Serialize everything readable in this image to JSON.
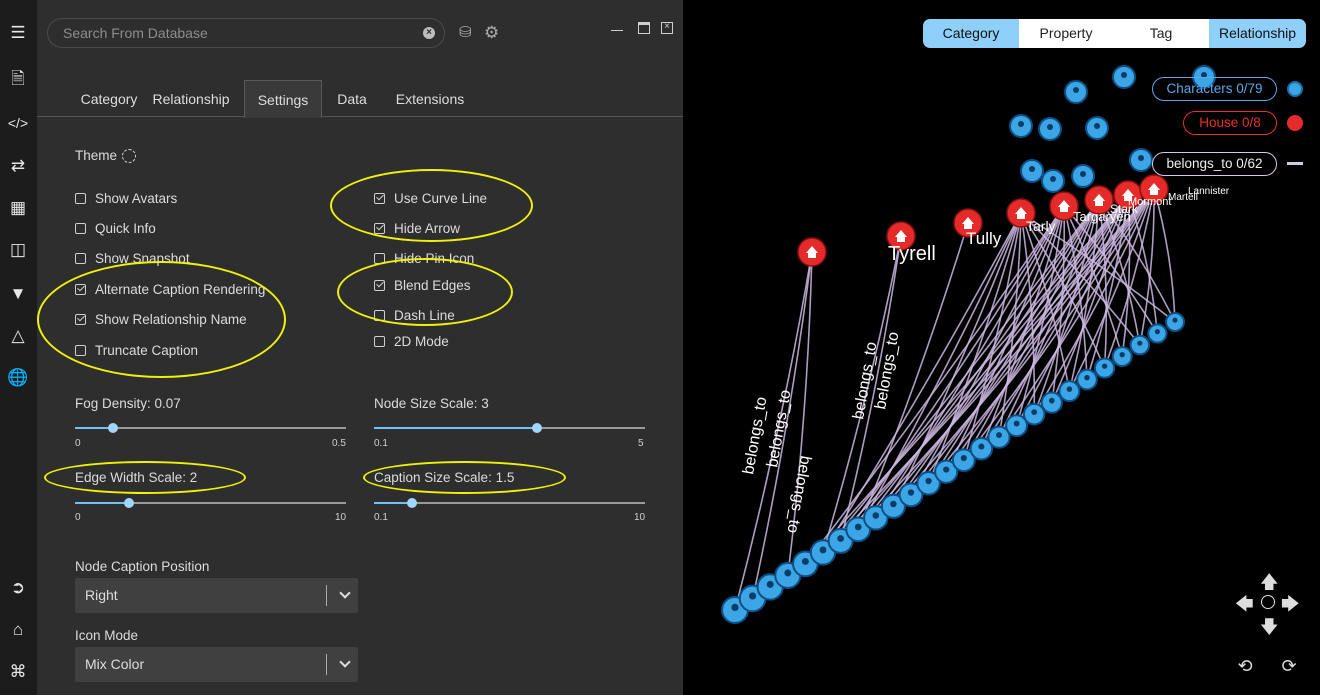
{
  "search": {
    "placeholder": "Search From Database"
  },
  "tabs": [
    "Category",
    "Relationship",
    "Settings",
    "Data",
    "Extensions"
  ],
  "settings": {
    "theme_label": "Theme",
    "left_options": [
      {
        "label": "Show Avatars",
        "checked": false
      },
      {
        "label": "Quick Info",
        "checked": false
      },
      {
        "label": "Show Snapshot",
        "checked": false
      },
      {
        "label": "Alternate Caption Rendering",
        "checked": true
      },
      {
        "label": "Show Relationship Name",
        "checked": true
      },
      {
        "label": "Truncate Caption",
        "checked": false
      }
    ],
    "right_options": [
      {
        "label": "Use Curve Line",
        "checked": true
      },
      {
        "label": "Hide Arrow",
        "checked": true
      },
      {
        "label": "Hide Pin Icon",
        "checked": false
      },
      {
        "label": "Blend Edges",
        "checked": true
      },
      {
        "label": "Dash Line",
        "checked": false
      },
      {
        "label": "2D Mode",
        "checked": false
      }
    ],
    "sliders": {
      "fog": {
        "label": "Fog Density: 0.07",
        "min": "0",
        "max": "0.5",
        "fraction": 0.14
      },
      "node_size": {
        "label": "Node Size Scale: 3",
        "min": "0.1",
        "max": "5",
        "fraction": 0.6
      },
      "edge_width": {
        "label": "Edge Width Scale: 2",
        "min": "0",
        "max": "10",
        "fraction": 0.2
      },
      "caption_size": {
        "label": "Caption Size Scale: 1.5",
        "min": "0.1",
        "max": "10",
        "fraction": 0.14
      }
    },
    "node_caption_position": {
      "label": "Node Caption Position",
      "value": "Right"
    },
    "icon_mode": {
      "label": "Icon Mode",
      "value": "Mix Color"
    }
  },
  "graph": {
    "segments": [
      "Category",
      "Property",
      "Tag",
      "Relationship"
    ],
    "legend": [
      {
        "label": "Characters 0/79",
        "color": "#5aa8e8"
      },
      {
        "label": "House 0/8",
        "color": "#e8302e"
      },
      {
        "label": "belongs_to 0/62",
        "color": "#d9c7e6"
      }
    ],
    "houses": [
      "Tyrell",
      "Tully",
      "Tarly",
      "Targaryen",
      "Stark",
      "Mormont",
      "Martell",
      "Lannister"
    ],
    "edge_label": "belongs_to",
    "colors": {
      "node": "#3ba5e6",
      "house": "#e52b2a",
      "edge": "#cdb8e0",
      "accent": "#8ed0fa",
      "highlight": "#eef20a"
    }
  }
}
